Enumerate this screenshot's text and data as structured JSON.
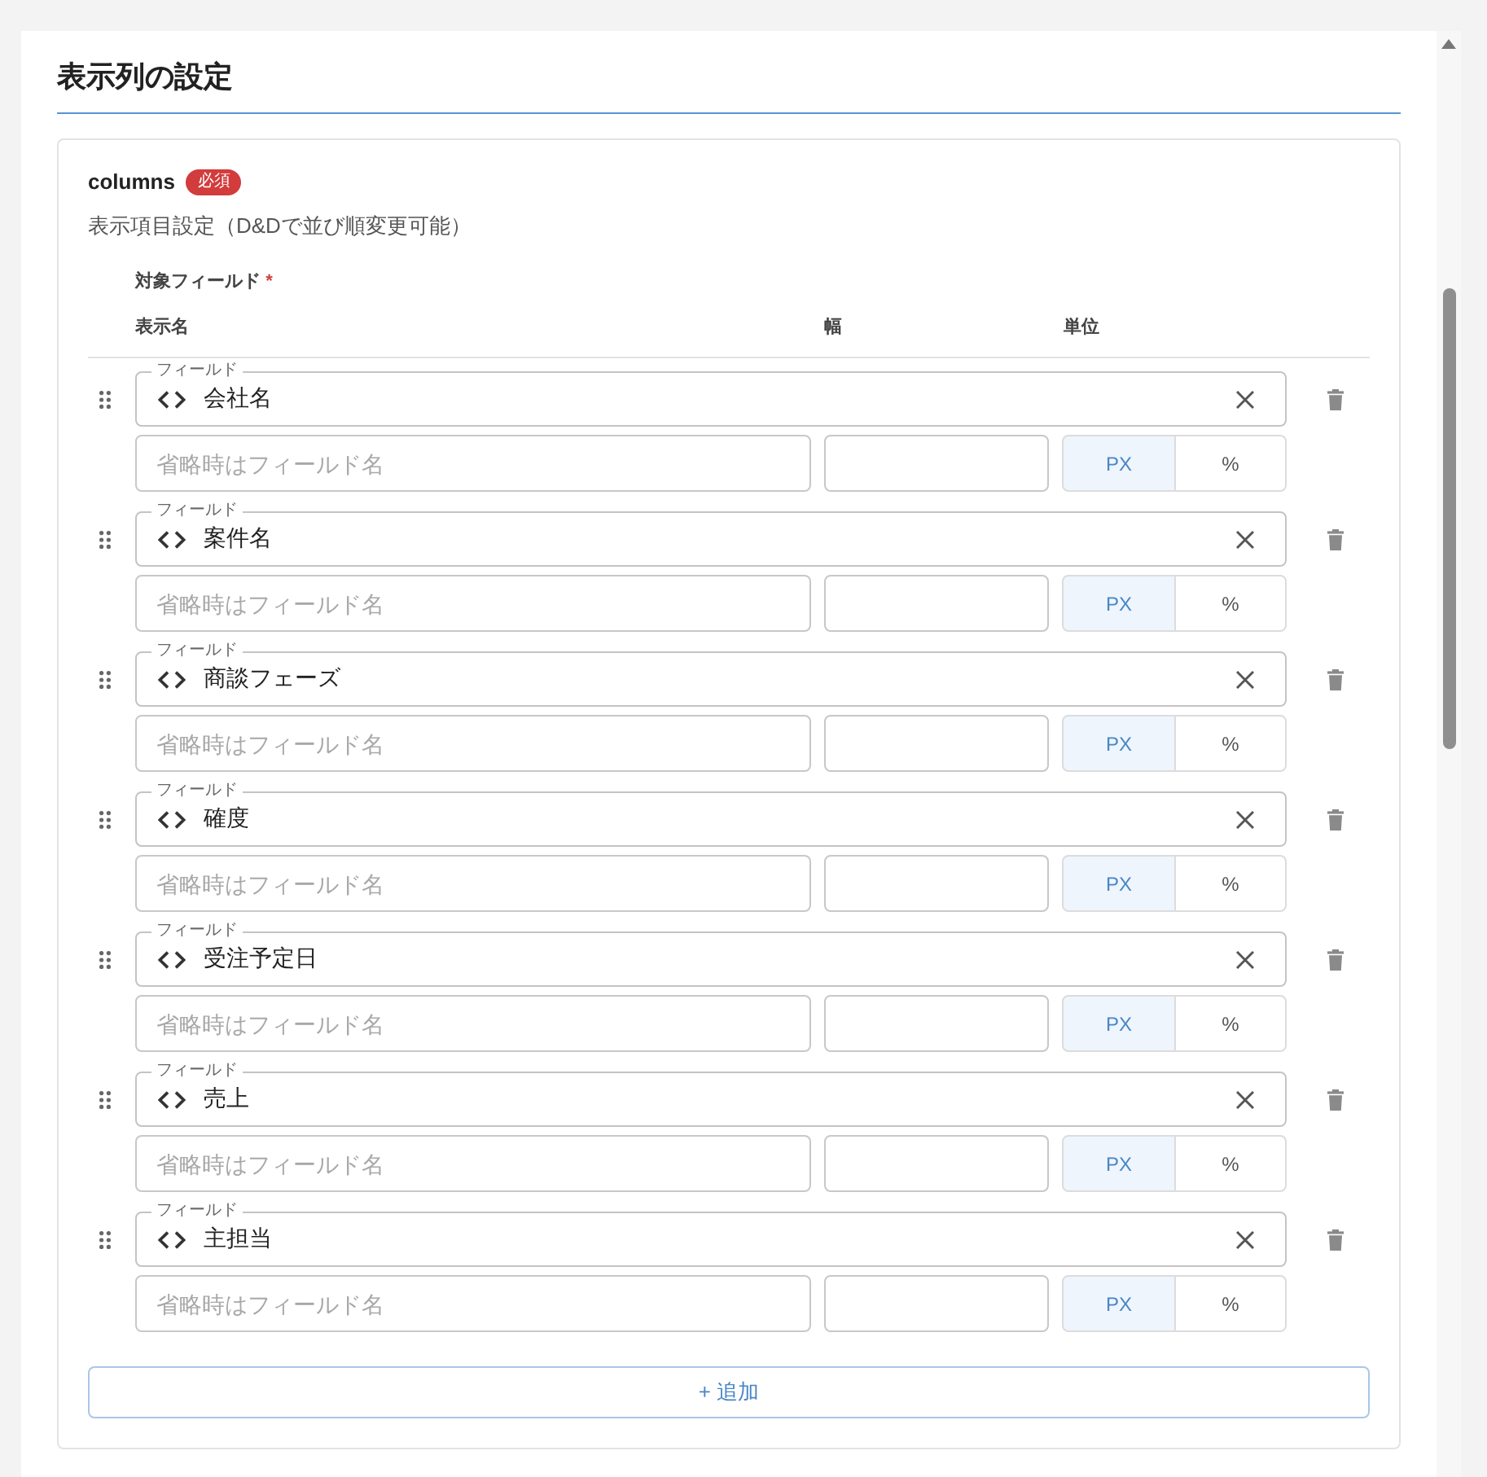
{
  "panel": {
    "title": "表示列の設定"
  },
  "property": {
    "name": "columns",
    "badge": "必須",
    "description": "表示項目設定（D&Dで並び順変更可能）",
    "field_group_label": "対象フィールド",
    "required_mark": "*"
  },
  "table": {
    "columns": [
      "表示名",
      "幅",
      "単位"
    ],
    "rows": [
      {
        "field_label": "フィールド",
        "field": "会社名",
        "display_name_placeholder": "省略時はフィールド名",
        "units": [
          {
            "label": "PX",
            "selected": true
          },
          {
            "label": "%",
            "selected": false
          }
        ]
      },
      {
        "field_label": "フィールド",
        "field": "案件名",
        "display_name_placeholder": "省略時はフィールド名",
        "units": [
          {
            "label": "PX",
            "selected": true
          },
          {
            "label": "%",
            "selected": false
          }
        ]
      },
      {
        "field_label": "フィールド",
        "field": "商談フェーズ",
        "display_name_placeholder": "省略時はフィールド名",
        "units": [
          {
            "label": "PX",
            "selected": true
          },
          {
            "label": "%",
            "selected": false
          }
        ]
      },
      {
        "field_label": "フィールド",
        "field": "確度",
        "display_name_placeholder": "省略時はフィールド名",
        "units": [
          {
            "label": "PX",
            "selected": true
          },
          {
            "label": "%",
            "selected": false
          }
        ]
      },
      {
        "field_label": "フィールド",
        "field": "受注予定日",
        "display_name_placeholder": "省略時はフィールド名",
        "units": [
          {
            "label": "PX",
            "selected": true
          },
          {
            "label": "%",
            "selected": false
          }
        ]
      },
      {
        "field_label": "フィールド",
        "field": "売上",
        "display_name_placeholder": "省略時はフィールド名",
        "units": [
          {
            "label": "PX",
            "selected": true
          },
          {
            "label": "%",
            "selected": false
          }
        ]
      },
      {
        "field_label": "フィールド",
        "field": "主担当",
        "display_name_placeholder": "省略時はフィールド名",
        "units": [
          {
            "label": "PX",
            "selected": true
          },
          {
            "label": "%",
            "selected": false
          }
        ]
      }
    ]
  },
  "add_button": "+ 追加"
}
